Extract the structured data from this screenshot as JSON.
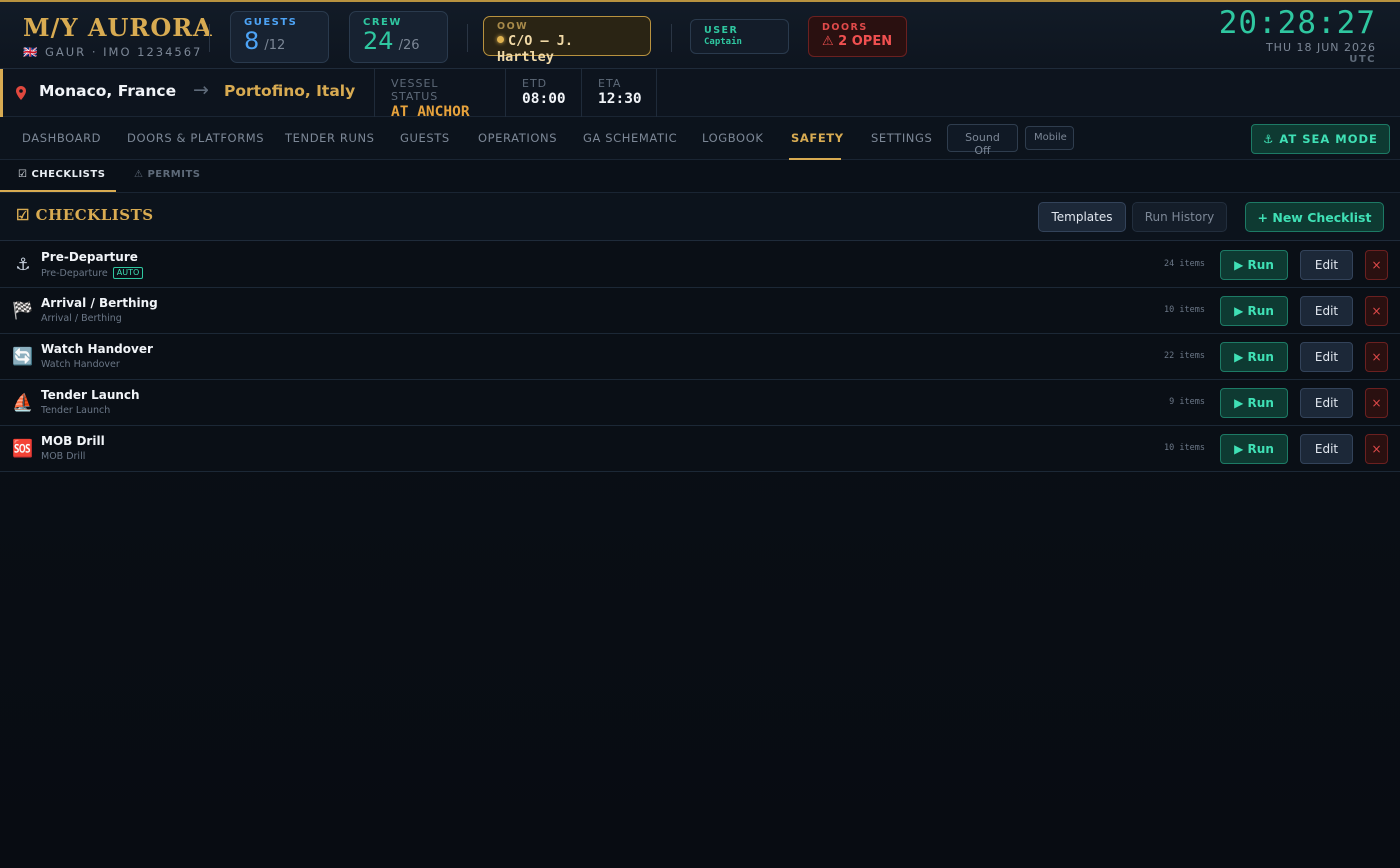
{
  "brand": {
    "name": "M/Y AURORA",
    "flag_icon": "uk-flag-icon",
    "flag": "🇬🇧",
    "sub": "GAUR · IMO 1234567"
  },
  "stats": {
    "guests": {
      "label": "GUESTS",
      "value": "8",
      "total": "/12"
    },
    "crew": {
      "label": "CREW",
      "value": "24",
      "total": "/26"
    }
  },
  "oow": {
    "label": "OOW",
    "value": "C/O — J. Hartley"
  },
  "user": {
    "label": "USER",
    "value": "Captain"
  },
  "doors": {
    "label": "DOORS",
    "value": "⚠ 2 OPEN"
  },
  "clock": {
    "time": "20:28:27",
    "date": "THU 18 JUN 2026",
    "tz": "UTC"
  },
  "route": {
    "origin": "Monaco, France",
    "arrow": "→",
    "destination": "Portofino, Italy",
    "status_label": "VESSEL STATUS",
    "status_value": "AT ANCHOR",
    "etd_label": "ETD",
    "etd_value": "08:00",
    "eta_label": "ETA",
    "eta_value": "12:30"
  },
  "nav": {
    "items": [
      "DASHBOARD",
      "DOORS & PLATFORMS",
      "TENDER RUNS",
      "GUESTS",
      "OPERATIONS",
      "GA SCHEMATIC",
      "LOGBOOK",
      "SAFETY",
      "SETTINGS"
    ],
    "active": "SAFETY",
    "sound_btn": "Sound Off",
    "mobile_btn": "Mobile",
    "sea_mode": "⚓ AT SEA MODE"
  },
  "subtabs": {
    "checklists": "☑ CHECKLISTS",
    "permits": "⚠ PERMITS"
  },
  "panel": {
    "title": "☑ CHECKLISTS",
    "templates_btn": "Templates",
    "history_btn": "Run History",
    "new_btn": "+ New Checklist"
  },
  "row_buttons": {
    "run": "▶ Run",
    "edit": "Edit",
    "delete": "×"
  },
  "checklists": [
    {
      "icon": "⚓",
      "icon_name": "anchor-icon",
      "name": "Pre-Departure",
      "sub": "Pre-Departure",
      "badge": "AUTO",
      "count": "24 items"
    },
    {
      "icon": "🏁",
      "icon_name": "checkered-flag-icon",
      "name": "Arrival / Berthing",
      "sub": "Arrival / Berthing",
      "badge": "",
      "count": "10 items"
    },
    {
      "icon": "🔄",
      "icon_name": "cycle-arrows-icon",
      "name": "Watch Handover",
      "sub": "Watch Handover",
      "badge": "",
      "count": "22 items"
    },
    {
      "icon": "⛵",
      "icon_name": "sailboat-icon",
      "name": "Tender Launch",
      "sub": "Tender Launch",
      "badge": "",
      "count": "9 items"
    },
    {
      "icon": "🆘",
      "icon_name": "sos-icon",
      "name": "MOB Drill",
      "sub": "MOB Drill",
      "badge": "",
      "count": "10 items"
    }
  ],
  "colors": {
    "accent_gold": "#d8ab52",
    "accent_teal": "#2fc7a0",
    "danger": "#e04a4a",
    "guests_blue": "#4da3f5"
  }
}
